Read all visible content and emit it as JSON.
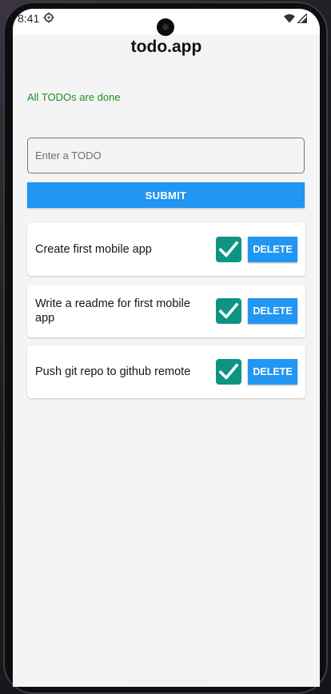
{
  "status_bar": {
    "time": "8:41",
    "settings_icon": "gear-icon",
    "wifi_icon": "wifi-icon",
    "signal_icon": "signal-icon"
  },
  "app": {
    "title": "todo.app",
    "status_message": "All TODOs are done",
    "status_color": "#1f8f1f"
  },
  "form": {
    "input_placeholder": "Enter a TODO",
    "input_value": "",
    "submit_label": "SUBMIT"
  },
  "todos": [
    {
      "text": "Create first mobile app",
      "done": true,
      "delete_label": "DELETE"
    },
    {
      "text": "Write a readme for first mobile app",
      "done": true,
      "delete_label": "DELETE"
    },
    {
      "text": "Push git repo to github remote",
      "done": true,
      "delete_label": "DELETE"
    }
  ],
  "colors": {
    "accent": "#2196f3",
    "checkbox": "#0e9483",
    "background": "#f4f4f4"
  }
}
